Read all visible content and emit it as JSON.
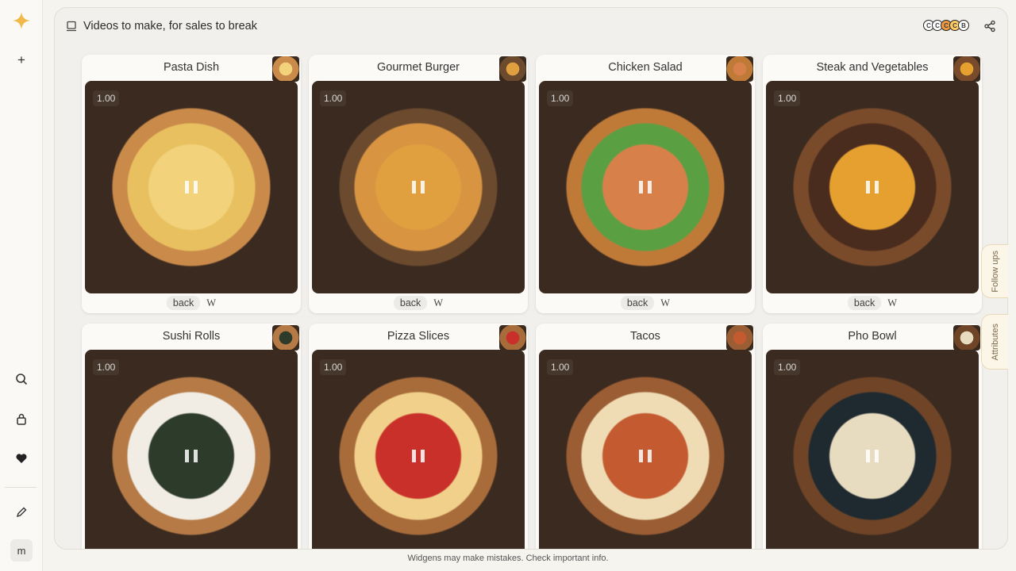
{
  "rail": {
    "logo_icon": "sparkle-logo",
    "new_label": "+",
    "avatar_initial": "m"
  },
  "header": {
    "title": "Videos to make, for sales to break",
    "collaborator_letters": [
      "C",
      "C",
      "C",
      "C",
      "B"
    ]
  },
  "cards": [
    {
      "name": "Pasta Dish",
      "score": "1.00",
      "back": "back",
      "w": "W",
      "colors": [
        "#c98a4a",
        "#e8c060",
        "#f2d27a"
      ]
    },
    {
      "name": "Gourmet Burger",
      "score": "1.00",
      "back": "back",
      "w": "W",
      "colors": [
        "#6b4a2e",
        "#d89440",
        "#e0a040"
      ]
    },
    {
      "name": "Chicken Salad",
      "score": "1.00",
      "back": "back",
      "w": "W",
      "colors": [
        "#c07a38",
        "#5aa043",
        "#d8804a"
      ]
    },
    {
      "name": "Steak and Vegetables",
      "score": "1.00",
      "back": "back",
      "w": "W",
      "colors": [
        "#7a4b2a",
        "#4a2c1e",
        "#e5a030"
      ]
    },
    {
      "name": "Sushi Rolls",
      "score": "1.00",
      "back": "",
      "w": "",
      "colors": [
        "#b57a46",
        "#f1ede4",
        "#2d3b2a"
      ]
    },
    {
      "name": "Pizza Slices",
      "score": "1.00",
      "back": "",
      "w": "",
      "colors": [
        "#a86b3a",
        "#f0d08a",
        "#c9302a"
      ]
    },
    {
      "name": "Tacos",
      "score": "1.00",
      "back": "",
      "w": "",
      "colors": [
        "#9a5d34",
        "#efdcb5",
        "#c45a30"
      ]
    },
    {
      "name": "Pho Bowl",
      "score": "1.00",
      "back": "",
      "w": "",
      "colors": [
        "#6f4427",
        "#1f2a30",
        "#e8dcc0"
      ]
    }
  ],
  "side_tabs": {
    "follow_ups": "Follow ups",
    "attributes": "Attributes"
  },
  "footer": "Widgens may make mistakes. Check important info."
}
